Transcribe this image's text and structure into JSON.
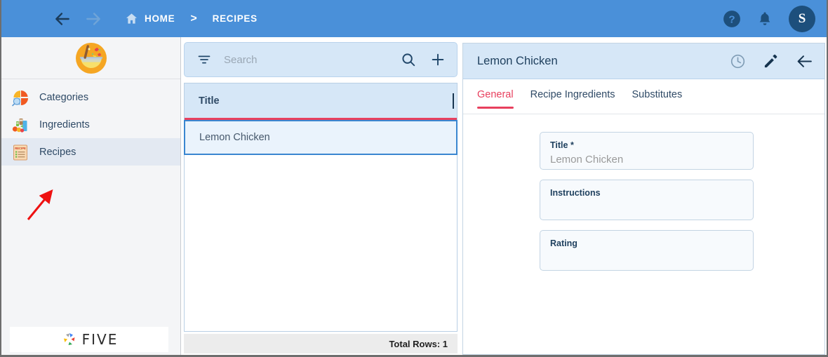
{
  "topbar": {
    "menu_icon": "hamburger-icon",
    "back_icon": "arrow-left-icon",
    "forward_icon": "arrow-right-icon",
    "home_icon": "home-icon",
    "breadcrumb_home": "HOME",
    "breadcrumb_separator": ">",
    "breadcrumb_current": "RECIPES",
    "help_icon": "help-circle-icon",
    "notifications_icon": "bell-icon",
    "avatar_initial": "S",
    "bg_color": "#4a90d9",
    "avatar_bg_color": "#1d4f7c"
  },
  "sidebar": {
    "logo_icon": "salad-bowl-logo",
    "items": [
      {
        "label": "Categories",
        "icon": "pie-chart-search-icon",
        "active": false
      },
      {
        "label": "Ingredients",
        "icon": "groceries-icon",
        "active": false
      },
      {
        "label": "Recipes",
        "icon": "recipe-card-icon",
        "active": true
      }
    ],
    "footer_brand": "FIVE",
    "active_bg_color": "#e3e9f2"
  },
  "annotation": {
    "arrow_color": "#ee1111",
    "points_to": "Recipes"
  },
  "list_panel": {
    "filter_icon": "filter-icon",
    "search_placeholder": "Search",
    "search_value": "",
    "search_icon": "search-icon",
    "add_icon": "plus-icon",
    "columns": [
      "Title"
    ],
    "rows": [
      {
        "title": "Lemon Chicken",
        "selected": true
      }
    ],
    "footer_label": "Total Rows: 1",
    "header_bg_color": "#d6e7f7",
    "header_underline_color": "#e8405e",
    "row_selected_border_color": "#3a86d0"
  },
  "detail_panel": {
    "title": "Lemon Chicken",
    "history_icon": "clock-icon",
    "edit_icon": "pencil-icon",
    "back_icon": "arrow-left-icon",
    "tabs": [
      {
        "label": "General",
        "active": true
      },
      {
        "label": "Recipe Ingredients",
        "active": false
      },
      {
        "label": "Substitutes",
        "active": false
      }
    ],
    "active_tab_color": "#e8405e",
    "fields": [
      {
        "label": "Title *",
        "value": "Lemon Chicken"
      },
      {
        "label": "Instructions",
        "value": ""
      },
      {
        "label": "Rating",
        "value": ""
      }
    ]
  }
}
